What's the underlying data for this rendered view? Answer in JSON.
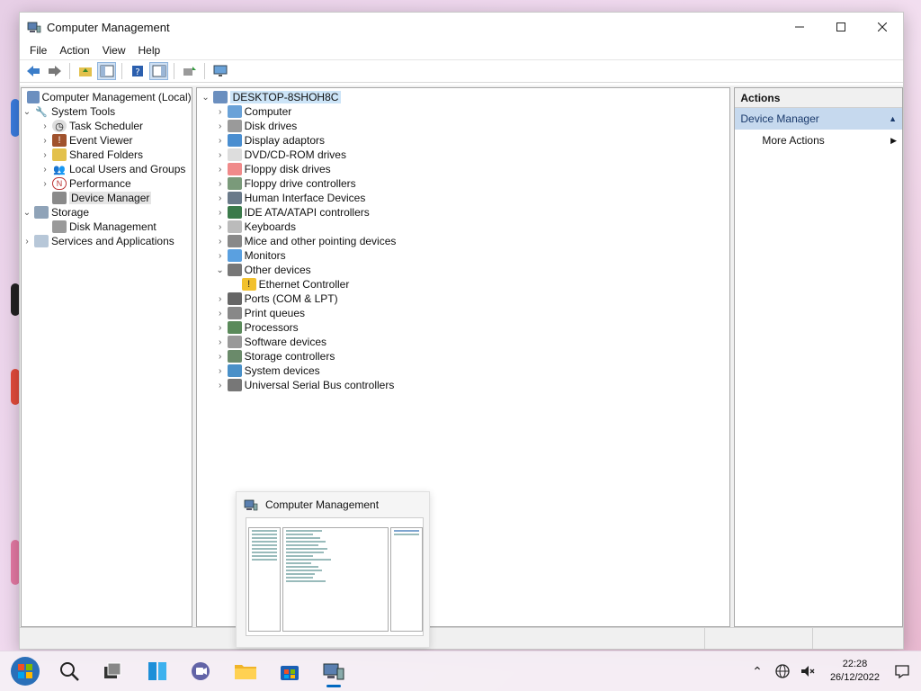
{
  "window": {
    "title": "Computer Management"
  },
  "menu": [
    "File",
    "Action",
    "View",
    "Help"
  ],
  "left_tree": {
    "root": "Computer Management (Local)",
    "system_tools": "System Tools",
    "tools": [
      "Task Scheduler",
      "Event Viewer",
      "Shared Folders",
      "Local Users and Groups",
      "Performance",
      "Device Manager"
    ],
    "storage": "Storage",
    "disk_management": "Disk Management",
    "services": "Services and Applications"
  },
  "device_tree": {
    "root": "DESKTOP-8SHOH8C",
    "categories": [
      "Computer",
      "Disk drives",
      "Display adaptors",
      "DVD/CD-ROM drives",
      "Floppy disk drives",
      "Floppy drive controllers",
      "Human Interface Devices",
      "IDE ATA/ATAPI controllers",
      "Keyboards",
      "Mice and other pointing devices",
      "Monitors",
      "Other devices",
      "Ports (COM & LPT)",
      "Print queues",
      "Processors",
      "Software devices",
      "Storage controllers",
      "System devices",
      "Universal Serial Bus controllers"
    ],
    "other_child": "Ethernet Controller"
  },
  "actions": {
    "header": "Actions",
    "section": "Device Manager",
    "more": "More Actions"
  },
  "thumbnail": {
    "title": "Computer Management"
  },
  "clock": {
    "time": "22:28",
    "date": "26/12/2022"
  },
  "colors": {
    "accent": "#0067c0",
    "selected_section": "#c6d9ee"
  }
}
